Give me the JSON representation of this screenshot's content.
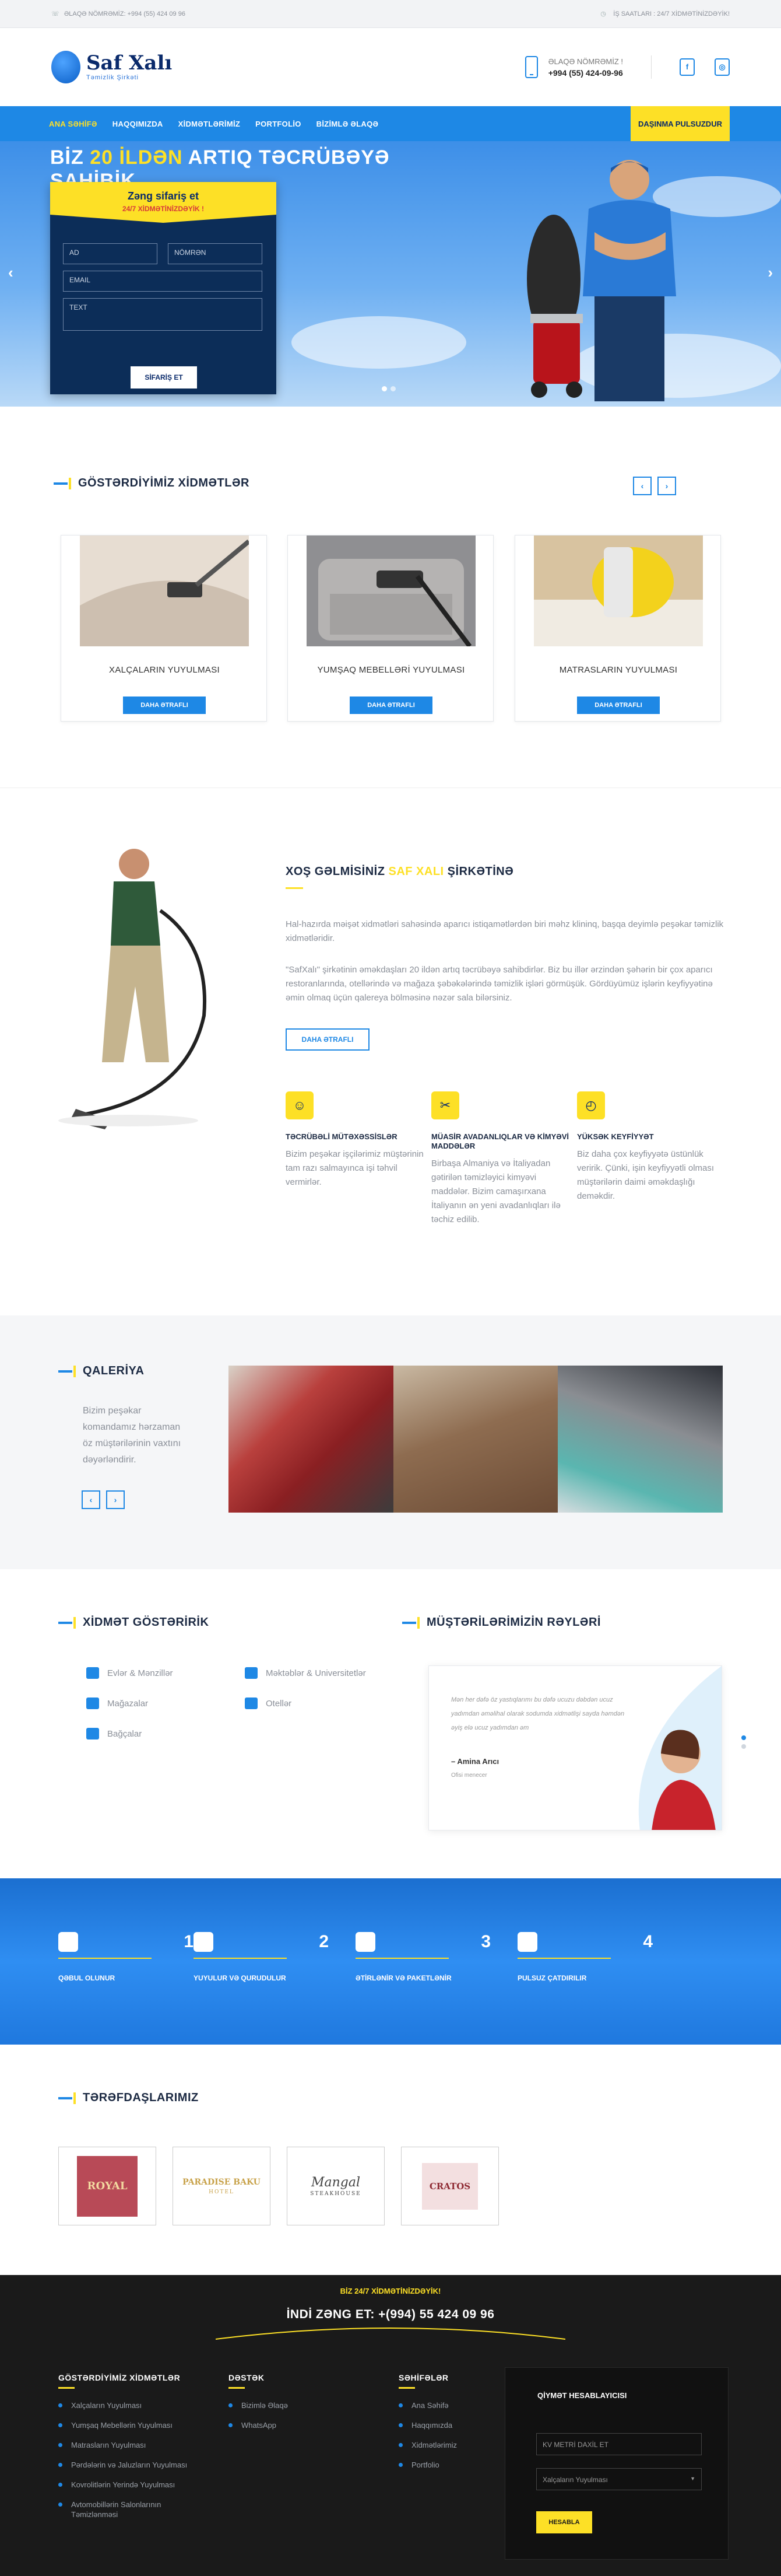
{
  "topbar": {
    "left": "ƏLAQƏ NÖMRƏMİZ: +994 (55) 424 09 96",
    "right": "İŞ SAATLARI : 24/7 XİDMƏTİNİZDƏYİK!"
  },
  "header": {
    "logo_name": "Saf Xalı",
    "logo_sub": "Təmizlik Şirkəti",
    "phone_label": "ƏLAQƏ NÖMRƏMİZ !",
    "phone_number": "+994 (55) 424-09-96"
  },
  "nav": {
    "items": [
      "ANA SƏHİFƏ",
      "HAQQIMIZDA",
      "XİDMƏTLƏRİMİZ",
      "PORTFOLİO",
      "BİZİMLƏ ƏLAQƏ"
    ],
    "cta": "DAŞINMA PULSUZDUR"
  },
  "hero": {
    "headline_a": "BİZ ",
    "headline_b": "20 İLDƏN",
    "headline_c": " ARTIQ TƏCRÜBƏYƏ SAHİBİK",
    "form_title": "Zəng sifariş et",
    "form_sub": "24/7 XİDMƏTİNİZDƏYİK !",
    "ph_name": "AD",
    "ph_phone": "NÖMRƏN",
    "ph_email": "EMAIL",
    "ph_text": "TEXT",
    "submit": "SİFARİŞ ET"
  },
  "services": {
    "title": "GÖSTƏRDİYİMİZ XİDMƏTLƏR",
    "more_label": "DAHA ƏTRAFLI",
    "cards": [
      {
        "caption": "XALÇALARIN YUYULMASI"
      },
      {
        "caption": "YUMŞAQ MEBELLƏRİ YUYULMASI"
      },
      {
        "caption": "MATRASLARIN YUYULMASI"
      }
    ]
  },
  "about": {
    "title_a": "XOŞ GƏLMİSİNİZ ",
    "title_b": "SAF XALI",
    "title_c": " ŞİRKƏTİNƏ",
    "p1": "Hal-hazırda məişət xidmətləri sahəsində aparıcı istiqamətlərdən biri məhz klininq, başqa deyimlə peşəkar təmizlik xidmətləridir.",
    "p2": "\"SafXalı\" şirkətinin əməkdaşları 20 ildən artıq təcrübəyə sahibdirlər. Biz bu illər ərzindən şəhərin bir çox aparıcı restoranlarında, otellərində və mağaza şəbəkələrində təmizlik işləri görmüşük. Gördüyümüz işlərin keyfiyyətinə əmin olmaq üçün qalereya bölməsinə nəzər sala bilərsiniz.",
    "more": "DAHA ƏTRAFLI",
    "features": [
      {
        "title": "TƏCRÜBƏLİ MÜTƏXƏSSİSLƏR",
        "text": "Bizim peşəkar işçilərimiz müştərinin tam razı salmayınca işi təhvil vermirlər."
      },
      {
        "title": "MÜASİR AVADANLIQLAR VƏ KİMYƏVİ MADDƏLƏR",
        "text": "Birbaşa Almaniya və İtaliyadan gətirilən təmizləyici kimyəvi maddələr. Bizim camaşırxana İtaliyanın ən yeni avadanlıqları ilə təchiz edilib."
      },
      {
        "title": "YÜKSƏK KEYFİYYƏT",
        "text": "Biz daha çox keyfiyyətə üstünlük veririk. Çünki, işin keyfiyyətli olması müştərilərin daimi əməkdaşlığı deməkdir."
      }
    ]
  },
  "gallery": {
    "title": "QALERİYA",
    "text": "Bizim peşəkar komandamız hərzaman öz müştərilərinin vaxtını dəyərləndirir."
  },
  "serve": {
    "title": "XİDMƏT GÖSTƏRİRİK",
    "items": [
      "Evlər & Mənzillər",
      "Məktəblər & Universitetlər",
      "Mağazalar",
      "Otellər",
      "Bağçalar"
    ]
  },
  "reviews": {
    "title": "MÜŞTƏRİLƏRİMİZİN RƏYLƏRİ",
    "text": "Mən her dəfə öz yastıqlarımı bu dəfə ucuzu dəbdən ucuz yadımdan əməlihal olarak sodumda xidmətlişi sayda həmdən əyiş elə ucuz yadımdan əm",
    "name": "– Amina Arıcı",
    "role": "Ofisi menecer"
  },
  "process": {
    "steps": [
      {
        "n": "1",
        "label": "QƏBUL OLUNUR"
      },
      {
        "n": "2",
        "label": "YUYULUR VƏ QURUDULUR"
      },
      {
        "n": "3",
        "label": "ƏTİRLƏNİR VƏ PAKETLƏNİR"
      },
      {
        "n": "4",
        "label": "PULSUZ ÇATDIRILIR"
      }
    ]
  },
  "partners": {
    "title": "TƏRƏFDAŞLARIMIZ",
    "logos": [
      "ROYAL",
      "PARADISE BAKU",
      "Mangal",
      "CRATOS"
    ],
    "logo_subs": [
      "",
      "HOTEL",
      "STEAKHOUSE",
      ""
    ]
  },
  "footer": {
    "cta_small": "BİZ 24/7 XİDMƏTİNİZDƏYİK!",
    "cta_big": "İNDİ ZƏNG ET: +(994) 55 424 09 96",
    "col1_title": "GÖSTƏRDİYİMİZ XİDMƏTLƏR",
    "col1": [
      "Xalçaların Yuyulması",
      "Yumşaq Mebellərin Yuyulması",
      "Matrasların Yuyulması",
      "Pərdələrin və Jaluzların Yuyulması",
      "Kovrolitlərin Yerində Yuyulması",
      "Avtomobillərin Salonlarının Təmizlənməsi"
    ],
    "col2_title": "DƏSTƏK",
    "col2": [
      "Bizimlə Əlaqə",
      "WhatsApp"
    ],
    "col3_title": "SƏHİFƏLƏR",
    "col3": [
      "Ana Səhifə",
      "Haqqımızda",
      "Xidmətlərimiz",
      "Portfolio"
    ],
    "calc_title": "QİYMƏT HESABLAYICISI",
    "calc_ph": "KV METRİ DAXİL ET",
    "calc_select": "Xalçaların Yuyulması",
    "calc_btn": "HESABLA"
  },
  "colors": {
    "primary": "#1e88e5",
    "accent": "#fde026",
    "dark": "#0c2d58"
  }
}
